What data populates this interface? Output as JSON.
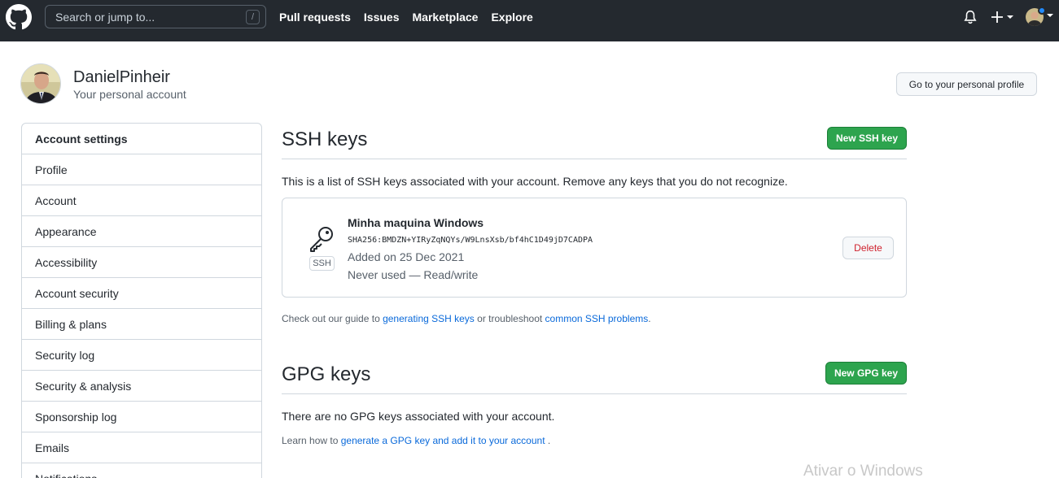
{
  "header": {
    "search_placeholder": "Search or jump to...",
    "search_shortcut": "/",
    "nav": [
      "Pull requests",
      "Issues",
      "Marketplace",
      "Explore"
    ]
  },
  "profile": {
    "name": "DanielPinheir",
    "subtitle": "Your personal account",
    "button": "Go to your personal profile"
  },
  "sidebar": {
    "title": "Account settings",
    "items": [
      "Profile",
      "Account",
      "Appearance",
      "Accessibility",
      "Account security",
      "Billing & plans",
      "Security log",
      "Security & analysis",
      "Sponsorship log",
      "Emails",
      "Notifications"
    ]
  },
  "ssh": {
    "title": "SSH keys",
    "new_button": "New SSH key",
    "description": "This is a list of SSH keys associated with your account. Remove any keys that you do not recognize.",
    "key": {
      "badge": "SSH",
      "name": "Minha maquina Windows",
      "fingerprint": "SHA256:BMDZN+YIRyZqNQYs/W9LnsXsb/bf4hC1D49jD7CADPA",
      "added": "Added on 25 Dec 2021",
      "usage": "Never used — Read/write",
      "delete": "Delete"
    },
    "guide_prefix": "Check out our guide to ",
    "guide_link1": "generating SSH keys",
    "guide_middle": " or troubleshoot ",
    "guide_link2": "common SSH problems",
    "guide_suffix": "."
  },
  "gpg": {
    "title": "GPG keys",
    "new_button": "New GPG key",
    "empty": "There are no GPG keys associated with your account.",
    "learn_prefix": "Learn how to ",
    "learn_link": "generate a GPG key and add it to your account",
    "learn_suffix": " ."
  },
  "watermark": "Ativar o Windows",
  "colors": {
    "header_bg": "#24292f",
    "green": "#2da44e",
    "link": "#0969da",
    "danger": "#cf222e"
  }
}
